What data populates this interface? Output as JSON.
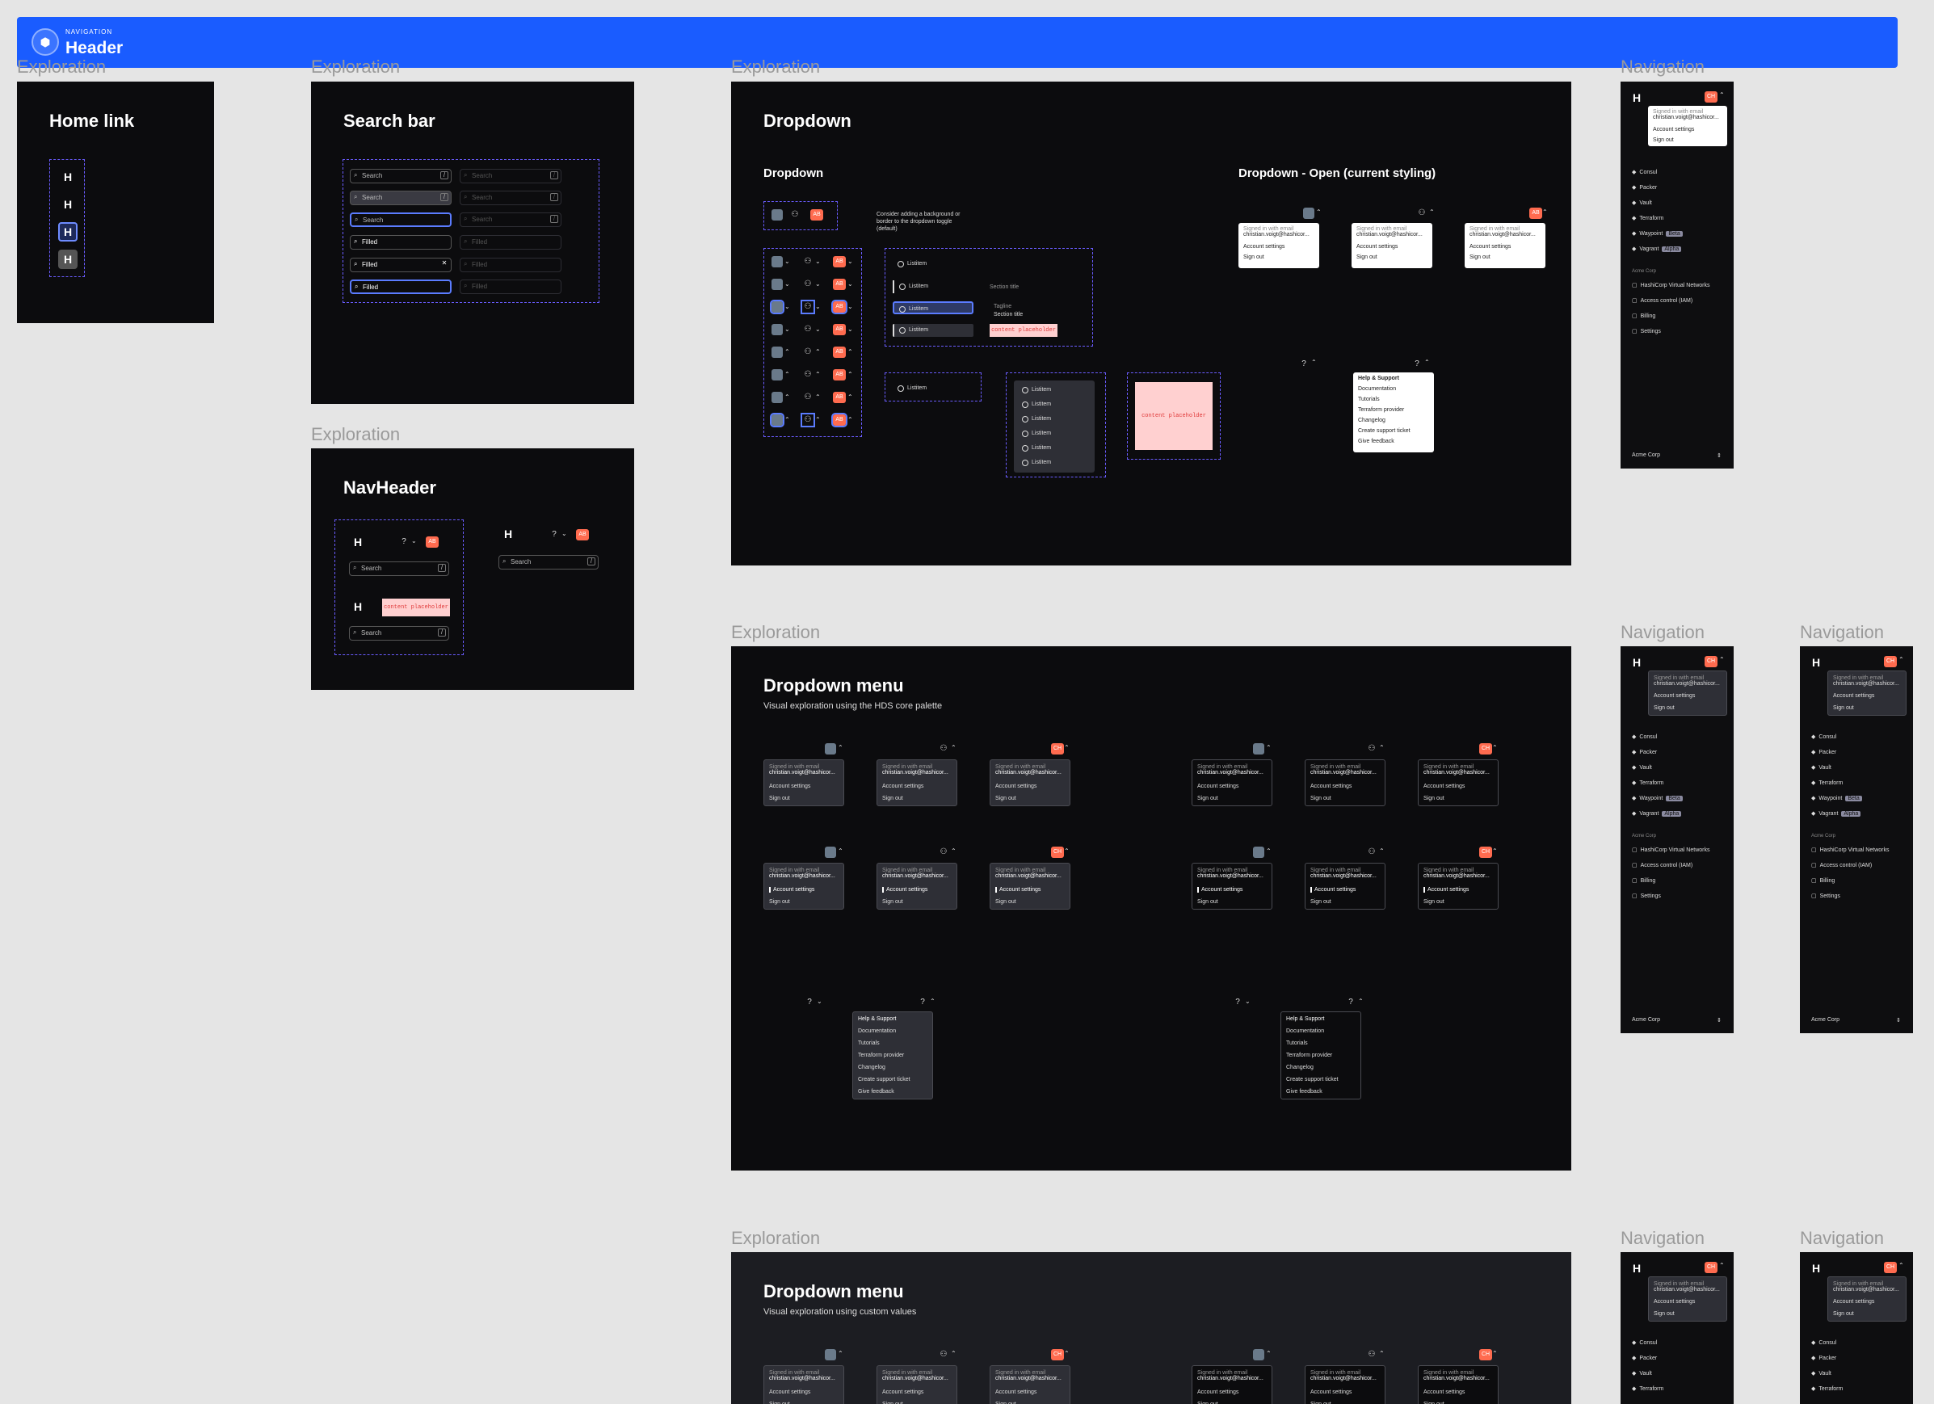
{
  "banner": {
    "overline": "NAVIGATION",
    "title": "Header"
  },
  "labels": {
    "exploration": "Exploration",
    "navigation": "Navigation"
  },
  "home_link": {
    "title": "Home link"
  },
  "search_bar": {
    "title": "Search bar",
    "rows": [
      {
        "left": "Search",
        "right": "Search"
      },
      {
        "left": "Search",
        "right": "Search"
      },
      {
        "left": "Search",
        "right": "Search"
      },
      {
        "left": "Filled",
        "right": "Filled"
      },
      {
        "left": "Filled",
        "right": "Filled"
      },
      {
        "left": "Filled",
        "right": "Filled"
      }
    ]
  },
  "navheader": {
    "title": "NavHeader",
    "search": "Search",
    "badge": "AB",
    "placeholder": "content placeholder"
  },
  "dropdown": {
    "title": "Dropdown",
    "subtitle": "Dropdown",
    "open_title": "Dropdown - Open (current styling)",
    "badge": "AB",
    "note": "Consider adding a background or border to the dropdown toggle (default)",
    "listitem": "Listitem",
    "section_title": "Section title",
    "tagline": "Tagline",
    "placeholder": "content placeholder",
    "user_menu": {
      "signed": "Signed in with email",
      "email": "christian.voigt@hashicor...",
      "settings": "Account settings",
      "signout": "Sign out"
    },
    "help_menu": {
      "heading": "Help & Support",
      "items": [
        "Documentation",
        "Tutorials",
        "Terraform provider",
        "Changelog",
        "Create support ticket",
        "Give feedback"
      ]
    }
  },
  "dropdown_menu_hds": {
    "title": "Dropdown menu",
    "subtitle": "Visual exploration using the HDS core palette",
    "badge": "CH"
  },
  "dropdown_menu_custom": {
    "title": "Dropdown menu",
    "subtitle": "Visual exploration using custom values",
    "badge": "CH"
  },
  "nav_panel": {
    "badge": "CH",
    "items": [
      "Consul",
      "Packer",
      "Vault",
      "Terraform",
      "Waypoint",
      "Vagrant"
    ],
    "tags": {
      "Waypoint": "Beta",
      "Vagrant": "Alpha"
    },
    "org": "Acme Corp",
    "org_items": [
      "HashiCorp Virtual Networks",
      "Access control (IAM)",
      "Billing",
      "Settings"
    ],
    "footer": "Acme Corp"
  }
}
